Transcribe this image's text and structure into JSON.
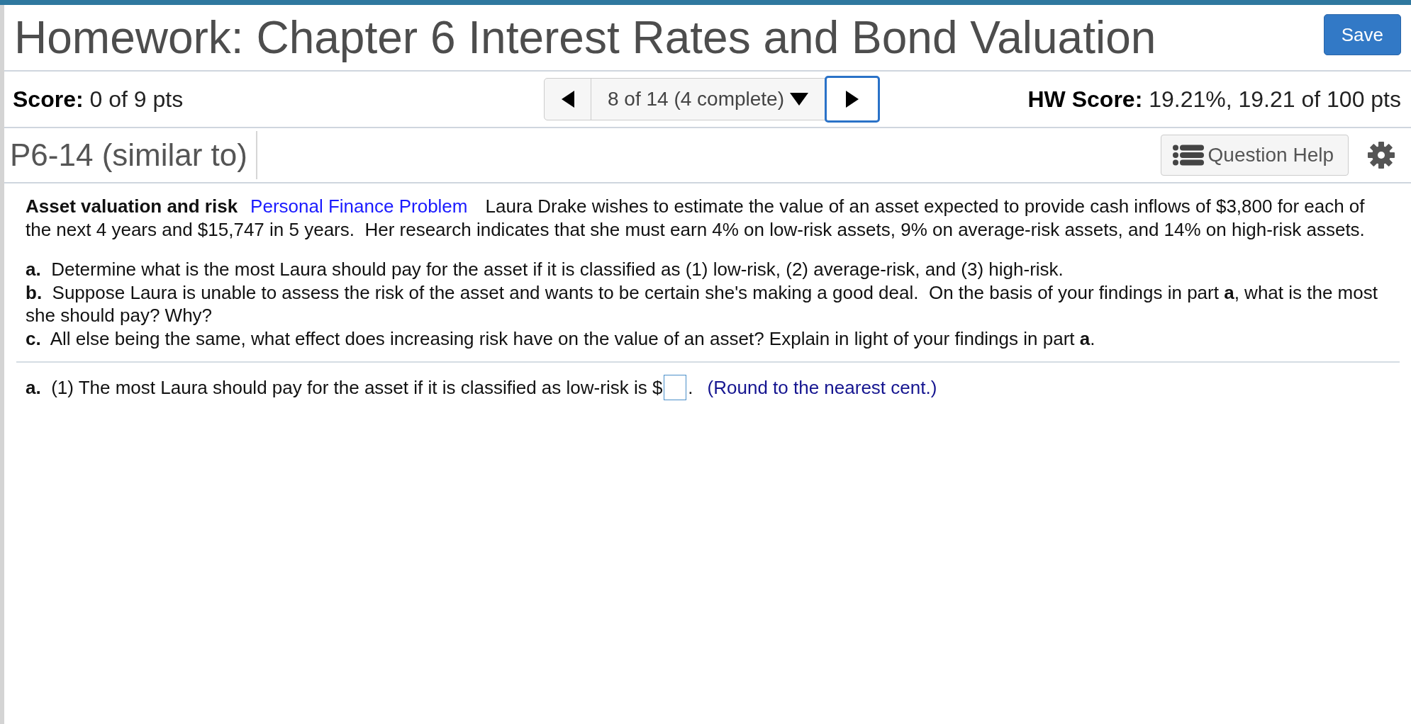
{
  "header": {
    "title": "Homework: Chapter 6 Interest Rates and Bond Valuation",
    "save_button": "Save"
  },
  "score_bar": {
    "score": {
      "label": "Score:",
      "value": "0 of 9 pts"
    },
    "navigation": {
      "position": "8 of 14 (4 complete)",
      "next_focused": true
    },
    "hw_score": {
      "label": "HW Score:",
      "value": "19.21%, 19.21 of 100 pts"
    }
  },
  "question_bar": {
    "question_id": "P6-14 (similar to)",
    "help_button": "Question Help"
  },
  "problem": {
    "title": "Asset valuation and risk",
    "category_link": "Personal Finance Problem",
    "statement": "Laura Drake wishes to estimate the value of an asset expected to provide cash inflows of $3,800 for each of the next 4 years and $15,747 in 5 years.  Her research indicates that she must earn 4% on low-risk assets, 9% on average-risk assets, and 14% on high-risk assets.",
    "parts": [
      {
        "label": "a.",
        "text": "Determine what is the most Laura should pay for the asset if it is classified as (1) low-risk, (2) average-risk, and (3) high-risk."
      },
      {
        "label": "b.",
        "text": "Suppose Laura is unable to assess the risk of the asset and wants to be certain she's making a good deal.  On the basis of your findings in part **a**, what is the most she should pay? Why?"
      },
      {
        "label": "c.",
        "text": "All else being the same, what effect does increasing risk have on the value of an asset? Explain in light of your findings in part **a**."
      }
    ]
  },
  "answer": {
    "label": "a.",
    "prompt": "(1) The most Laura should pay for the asset if it is classified as low-risk is $",
    "suffix": ".",
    "hint": "(Round to the nearest cent.)"
  }
}
